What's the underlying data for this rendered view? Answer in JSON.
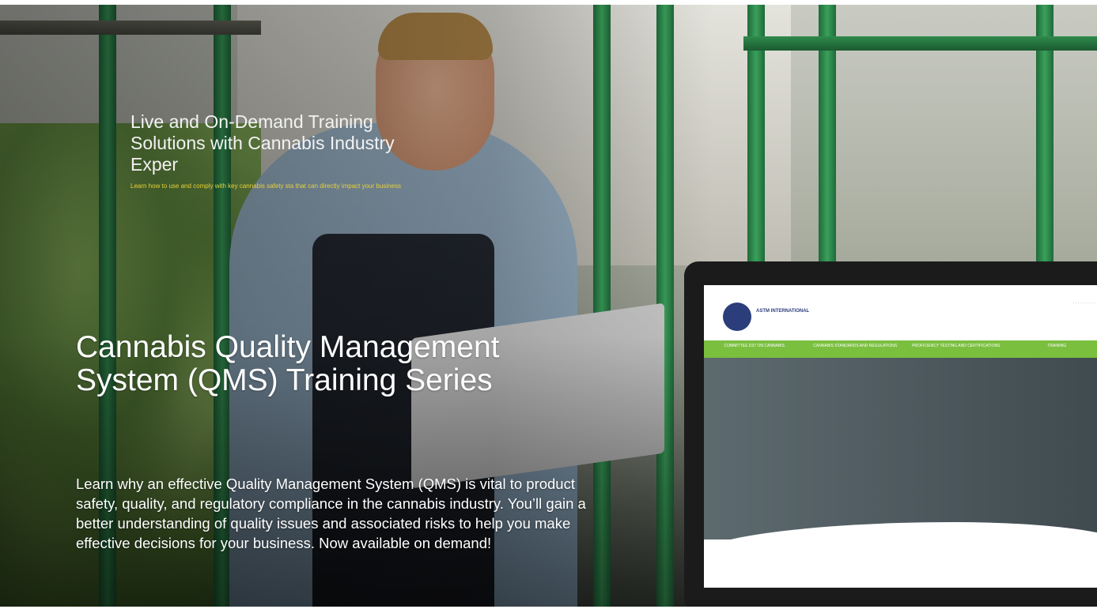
{
  "hero": {
    "title": "Cannabis Quality Management System (QMS) Training Series",
    "description": "Learn why an effective Quality Management System (QMS) is vital to product safety, quality, and regulatory compliance in the cannabis industry. You’ll gain a better understanding of quality issues and associated risks to help you make effective decisions for your business. Now available on demand!"
  },
  "mockup": {
    "site_name": "ASTM INTERNATIONAL",
    "nav": [
      "COMMITTEE D37 ON CANNABIS",
      "CANNABIS STANDARDS AND REGULATIONS",
      "PROFICIENCY TESTING AND CERTIFICATIONS",
      "TRAINING"
    ],
    "banner_title": "Live and On-Demand Training Solutions with Cannabis Industry Exper",
    "banner_subtitle": "Learn how to use and comply with key cannabis safety sta that can directly impact your business"
  },
  "colors": {
    "nav_green": "#7bbf3f",
    "banner_sub_yellow": "#e7d23a"
  }
}
